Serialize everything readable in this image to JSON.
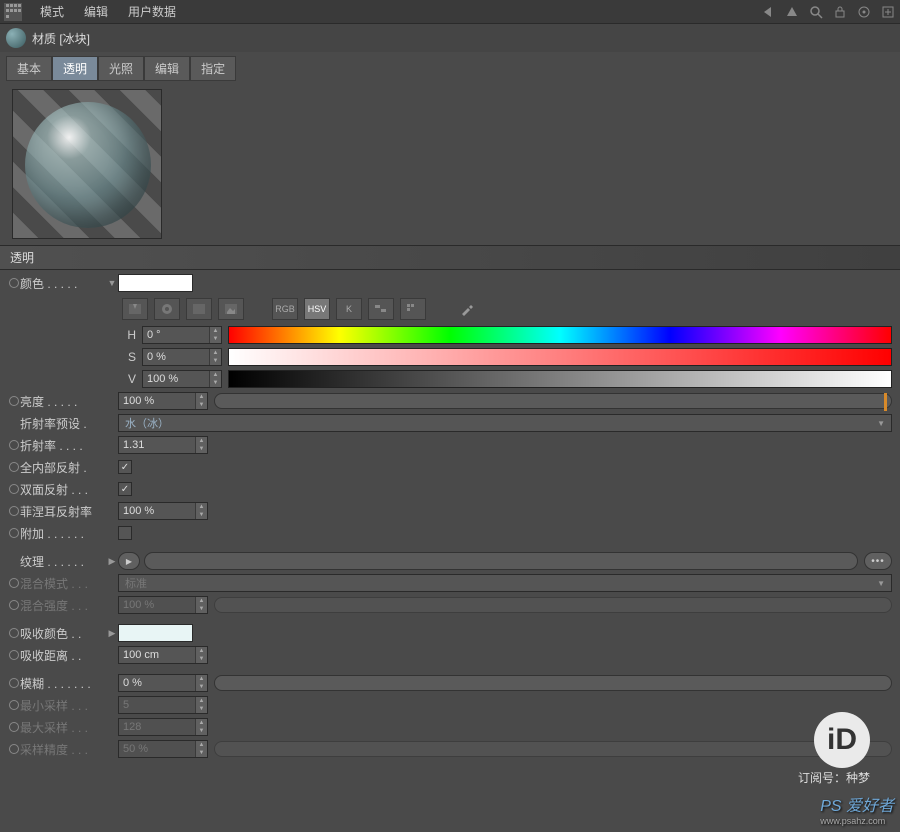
{
  "menubar": {
    "items": [
      "模式",
      "编辑",
      "用户数据"
    ]
  },
  "title": "材质 [冰块]",
  "tabs": [
    "基本",
    "透明",
    "光照",
    "编辑",
    "指定"
  ],
  "active_tab_index": 1,
  "section": {
    "header": "透明"
  },
  "rows": {
    "color": {
      "label": "颜色 . . . . ."
    },
    "brightness": {
      "label": "亮度 . . . . .",
      "value": "100 %"
    },
    "refraction_preset": {
      "label": "折射率预设 .",
      "value": "水（冰）"
    },
    "refraction": {
      "label": "折射率 . . . .",
      "value": "1.31"
    },
    "total_internal": {
      "label": "全内部反射 .",
      "checked": true
    },
    "double_sided": {
      "label": "双面反射 . . .",
      "checked": true
    },
    "fresnel": {
      "label": "菲涅耳反射率",
      "value": "100 %"
    },
    "additive": {
      "label": "附加 . . . . . .",
      "checked": false
    },
    "texture": {
      "label": "纹理 . . . . . ."
    },
    "mix_mode": {
      "label": "混合模式 . . .",
      "value": "标准"
    },
    "mix_strength": {
      "label": "混合强度 . . .",
      "value": "100 %"
    },
    "absorption_color": {
      "label": "吸收颜色 . ."
    },
    "absorption_dist": {
      "label": "吸收距离 . .",
      "value": "100 cm"
    },
    "blur": {
      "label": "模糊 . . . . . . .",
      "value": "0 %"
    },
    "min_samples": {
      "label": "最小采样 . . .",
      "value": "5"
    },
    "max_samples": {
      "label": "最大采样 . . .",
      "value": "128"
    },
    "sample_precision": {
      "label": "采样精度 . . .",
      "value": "50 %"
    }
  },
  "hsv": {
    "h": {
      "label": "H",
      "value": "0 °"
    },
    "s": {
      "label": "S",
      "value": "0 %"
    },
    "v": {
      "label": "V",
      "value": "100 %"
    }
  },
  "picker_tools": {
    "rgb": "RGB",
    "hsv": "HSV",
    "k": "K"
  },
  "watermark": {
    "sub": "订阅号：种梦",
    "ps": "PS 爱好者",
    "url": "www.psahz.com"
  }
}
